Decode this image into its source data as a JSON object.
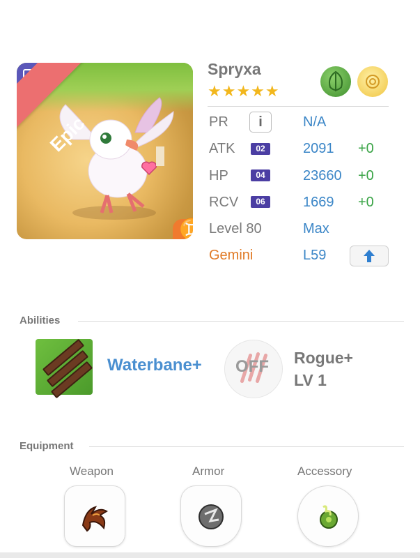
{
  "monster": {
    "name": "Spryxa",
    "stars": "★★★★★",
    "rarity": "Epic",
    "rarity_badge": "R",
    "zodiac_glyph": "♊",
    "elements": [
      "leaf-icon",
      "cloud-icon"
    ]
  },
  "stats": {
    "pr": {
      "label": "PR",
      "info": "i",
      "value": "N/A"
    },
    "atk": {
      "label": "ATK",
      "chip": "02",
      "value": "2091",
      "bonus": "+0"
    },
    "hp": {
      "label": "HP",
      "chip": "04",
      "value": "23660",
      "bonus": "+0"
    },
    "rcv": {
      "label": "RCV",
      "chip": "06",
      "value": "1669",
      "bonus": "+0"
    },
    "level": {
      "label": "Level 80",
      "value": "Max"
    },
    "zodiac": {
      "label": "Gemini",
      "value": "L59",
      "button_icon": "up-arrow-icon"
    }
  },
  "abilities": {
    "title": "Abilities",
    "ability_name": "Waterbane+",
    "toggle": "OFF",
    "skill_name": "Rogue+",
    "skill_level": "LV 1"
  },
  "equipment": {
    "title": "Equipment",
    "slots": [
      {
        "label": "Weapon",
        "icon": "claw-weapon-icon"
      },
      {
        "label": "Armor",
        "icon": "armor-orb-icon"
      },
      {
        "label": "Accessory",
        "icon": "green-gem-icon"
      }
    ]
  },
  "colors": {
    "accent_blue": "#3b86c7",
    "bonus_green": "#3aa446",
    "gemini_orange": "#e07a26",
    "epic_red": "#ec6f70"
  }
}
